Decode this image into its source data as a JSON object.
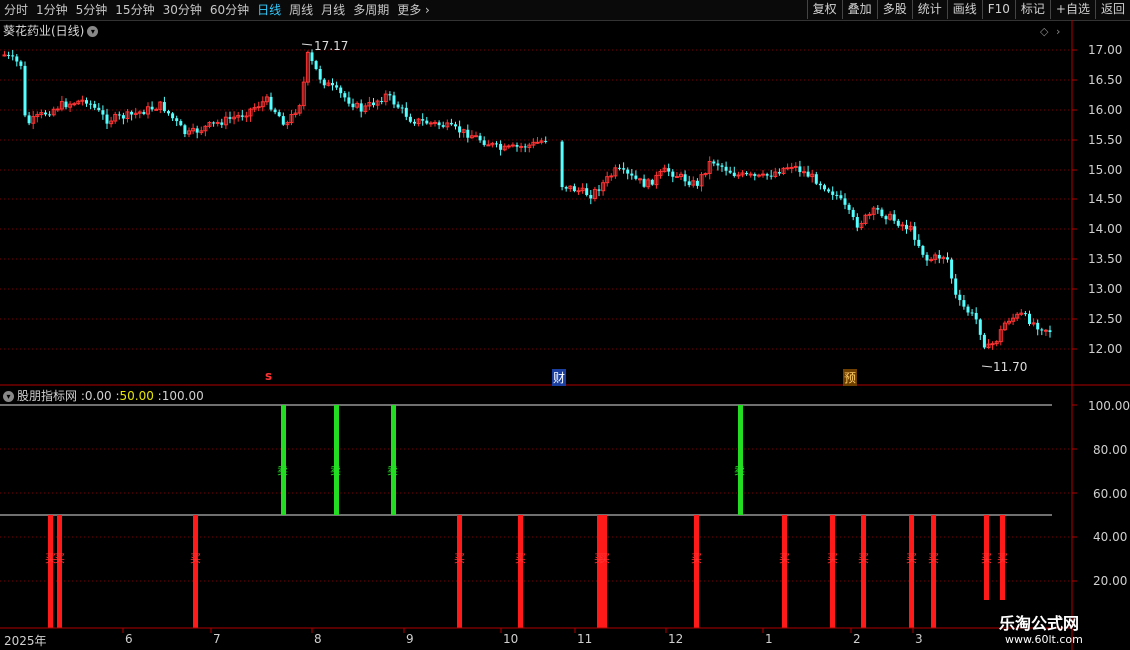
{
  "toolbar": {
    "periods": [
      "分时",
      "1分钟",
      "5分钟",
      "15分钟",
      "30分钟",
      "60分钟",
      "日线",
      "周线",
      "月线",
      "多周期",
      "更多"
    ],
    "active_period": "日线",
    "right_buttons": [
      "复权",
      "叠加",
      "多股",
      "统计",
      "画线",
      "F10",
      "标记",
      "+自选",
      "返回"
    ]
  },
  "stock": {
    "title": "葵花药业(日线)",
    "high_label": "17.17",
    "low_label": "11.70"
  },
  "price_axis": {
    "ticks": [
      "17.00",
      "16.50",
      "16.00",
      "15.50",
      "15.00",
      "14.50",
      "14.00",
      "13.50",
      "13.00",
      "12.50",
      "12.00"
    ]
  },
  "event_markers": {
    "s_label": "s",
    "finance_label": "财",
    "forecast_label": "预"
  },
  "indicator": {
    "name": "股朋指标网",
    "sep": ":",
    "v0": "0.00",
    "v50": "50.00",
    "v100": "100.00",
    "axis_ticks": [
      "100.00",
      "80.00",
      "60.00",
      "40.00",
      "20.00"
    ],
    "sell_label": "卖",
    "buy_label": "买"
  },
  "time_axis": {
    "labels": [
      "2025年",
      "6",
      "7",
      "8",
      "9",
      "10",
      "11",
      "12",
      "1",
      "2",
      "3"
    ]
  },
  "watermark": {
    "name": "乐淘公式网",
    "url": "www.60lt.com"
  },
  "colors": {
    "up": "#ff3333",
    "down": "#54ffff",
    "grid": "#7a0000",
    "sell_bar": "#22dd22",
    "buy_bar": "#ff1a1a",
    "axis": "#b00000"
  }
}
